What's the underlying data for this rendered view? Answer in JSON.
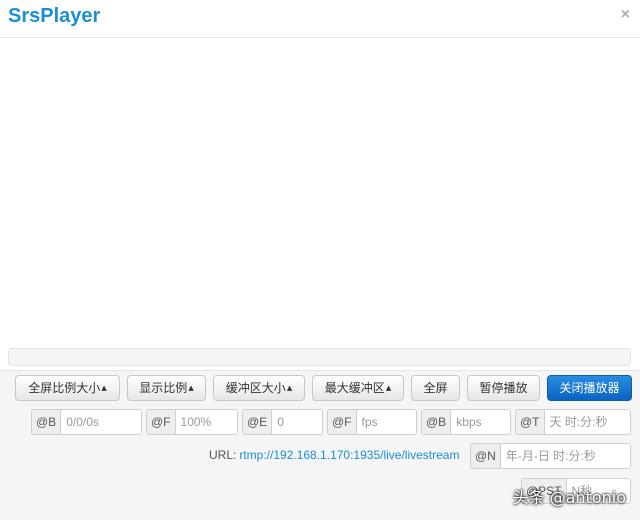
{
  "header": {
    "title": "SrsPlayer",
    "close_glyph": "×"
  },
  "toolbar": {
    "fullscreen_ratio": "全屏比例大小",
    "display_ratio": "显示比例",
    "buffer_size": "缓冲区大小",
    "max_buffer": "最大缓冲区",
    "fullscreen": "全屏",
    "pause": "暂停播放",
    "close_player": "关闭播放器",
    "caret": "▲"
  },
  "stats": {
    "time": {
      "prefix": "@B",
      "value": "0/0/0s"
    },
    "volume": {
      "prefix": "@F",
      "value": "100%"
    },
    "buffer": {
      "prefix": "@E",
      "value": "0"
    },
    "fps": {
      "prefix": "@F",
      "value": "fps"
    },
    "bitrate": {
      "prefix": "@B",
      "value": "kbps"
    },
    "uptime": {
      "prefix": "@T",
      "value": "天 时:分:秒"
    }
  },
  "url": {
    "label": "URL:",
    "value": "rtmp://192.168.1.170:1935/live/livestream"
  },
  "clock": {
    "prefix": "@N",
    "value": "年-月-日 时:分:秒"
  },
  "pts": {
    "prefix": "@PST",
    "value": "N秒"
  },
  "watermark": "头条 @antonio",
  "colors": {
    "accent": "#1a8fd6",
    "primary_button": "#0a63c2"
  }
}
